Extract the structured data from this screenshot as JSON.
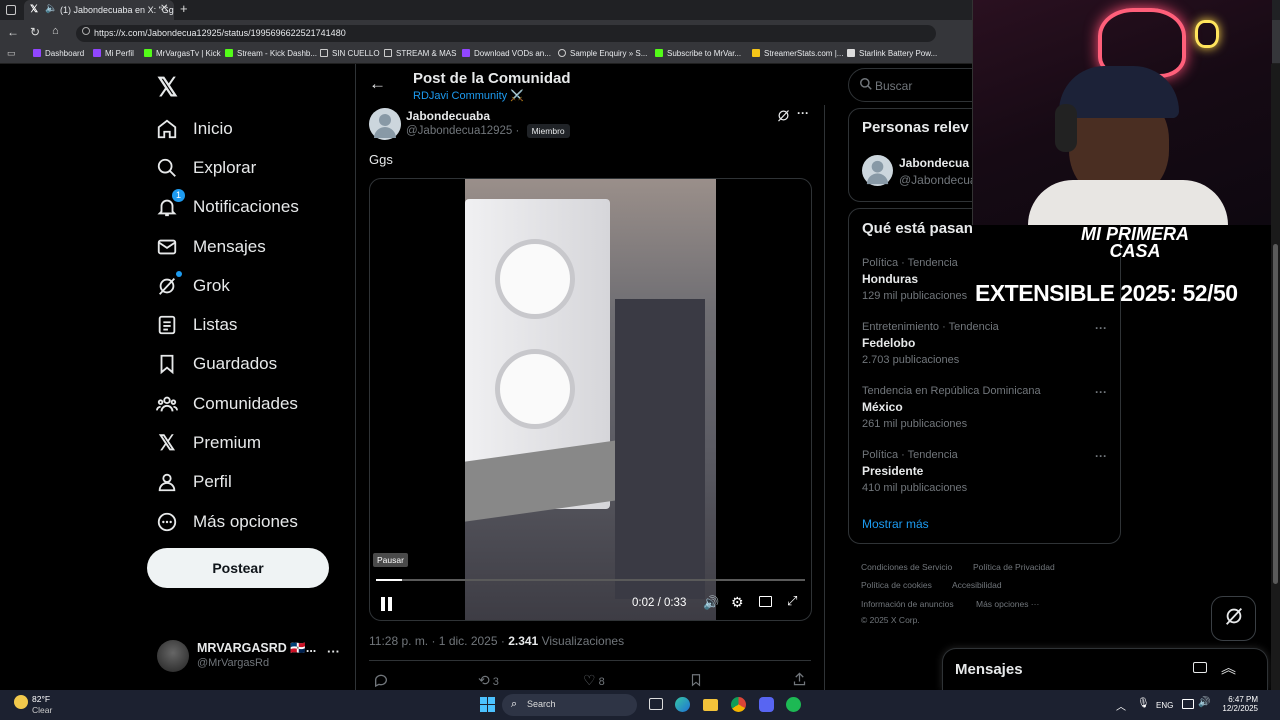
{
  "browser": {
    "tab_title": "(1) Jabondecuaba en X: \"Gg",
    "url": "https://x.com/Jabondecua12925/status/1995696622521741480",
    "bookmarks": [
      "Dashboard",
      "Mi Perfil",
      "MrVargasTv | Kick",
      "Stream - Kick Dashb...",
      "SIN CUELLO",
      "STREAM & MAS",
      "Download VODs an...",
      "Sample Enquiry » S...",
      "Subscribe to MrVar...",
      "StreamerStats.com |...",
      "Starlink Battery Pow..."
    ]
  },
  "sidebar": {
    "items": [
      {
        "label": "Inicio",
        "icon": "home-icon"
      },
      {
        "label": "Explorar",
        "icon": "search-icon"
      },
      {
        "label": "Notificaciones",
        "icon": "bell-icon",
        "badge": "1"
      },
      {
        "label": "Mensajes",
        "icon": "mail-icon"
      },
      {
        "label": "Grok",
        "icon": "grok-icon"
      },
      {
        "label": "Listas",
        "icon": "list-icon"
      },
      {
        "label": "Guardados",
        "icon": "bookmark-icon"
      },
      {
        "label": "Comunidades",
        "icon": "communities-icon"
      },
      {
        "label": "Premium",
        "icon": "x-logo-icon"
      },
      {
        "label": "Perfil",
        "icon": "person-icon"
      },
      {
        "label": "Más opciones",
        "icon": "more-circle-icon"
      }
    ],
    "post_button": "Postear",
    "account": {
      "name": "MRVARGASRD 🇩🇴...",
      "handle": "@MrVargasRd"
    }
  },
  "header": {
    "title": "Post de la Comunidad",
    "community": "RDJavi Community ⚔️"
  },
  "post": {
    "author_name": "Jabondecuaba",
    "author_handle": "@Jabondecua12925",
    "separator": "·",
    "role_badge": "Miembro",
    "text": "Ggs",
    "video": {
      "tooltip": "Pausar",
      "time": "0:02 / 0:33",
      "progress": 0.06
    },
    "meta_time": "11:28 p. m. · 1 dic. 2025 ·",
    "views_count": "2.341",
    "views_label": "Visualizaciones",
    "reposts": "3",
    "likes": "8"
  },
  "right": {
    "search_placeholder": "Buscar",
    "who_to_follow_title": "Personas relev",
    "follow_name": "Jabondecua",
    "follow_handle": "@Jabondecua",
    "trends_title": "Qué está pasan",
    "trends": [
      {
        "sub": "Política · Tendencia",
        "name": "Honduras",
        "count": "129 mil publicaciones"
      },
      {
        "sub": "Entretenimiento · Tendencia",
        "name": "Fedelobo",
        "count": "2.703 publicaciones"
      },
      {
        "sub": "Tendencia en República Dominicana",
        "name": "México",
        "count": "261 mil publicaciones"
      },
      {
        "sub": "Política · Tendencia",
        "name": "Presidente",
        "count": "410 mil publicaciones"
      }
    ],
    "show_more": "Mostrar más",
    "footer": [
      "Condiciones de Servicio",
      "Política de Privacidad",
      "Política de cookies",
      "Accesibilidad",
      "Información de anuncios",
      "Más opciones ···",
      "© 2025 X Corp."
    ],
    "messages_title": "Mensajes"
  },
  "overlay": {
    "logo_text": "MI PRIMERA CASA",
    "counter_text": "EXTENSIBLE 2025: 52/50"
  },
  "taskbar": {
    "weather_temp": "82°F",
    "weather_desc": "Clear",
    "search": "Search",
    "lang": "ENG",
    "time": "6:47 PM",
    "date": "12/2/2025"
  },
  "colors": {
    "accent": "#1d9bf0",
    "bg": "#000000",
    "border": "#2f3336",
    "muted": "#71767b"
  }
}
